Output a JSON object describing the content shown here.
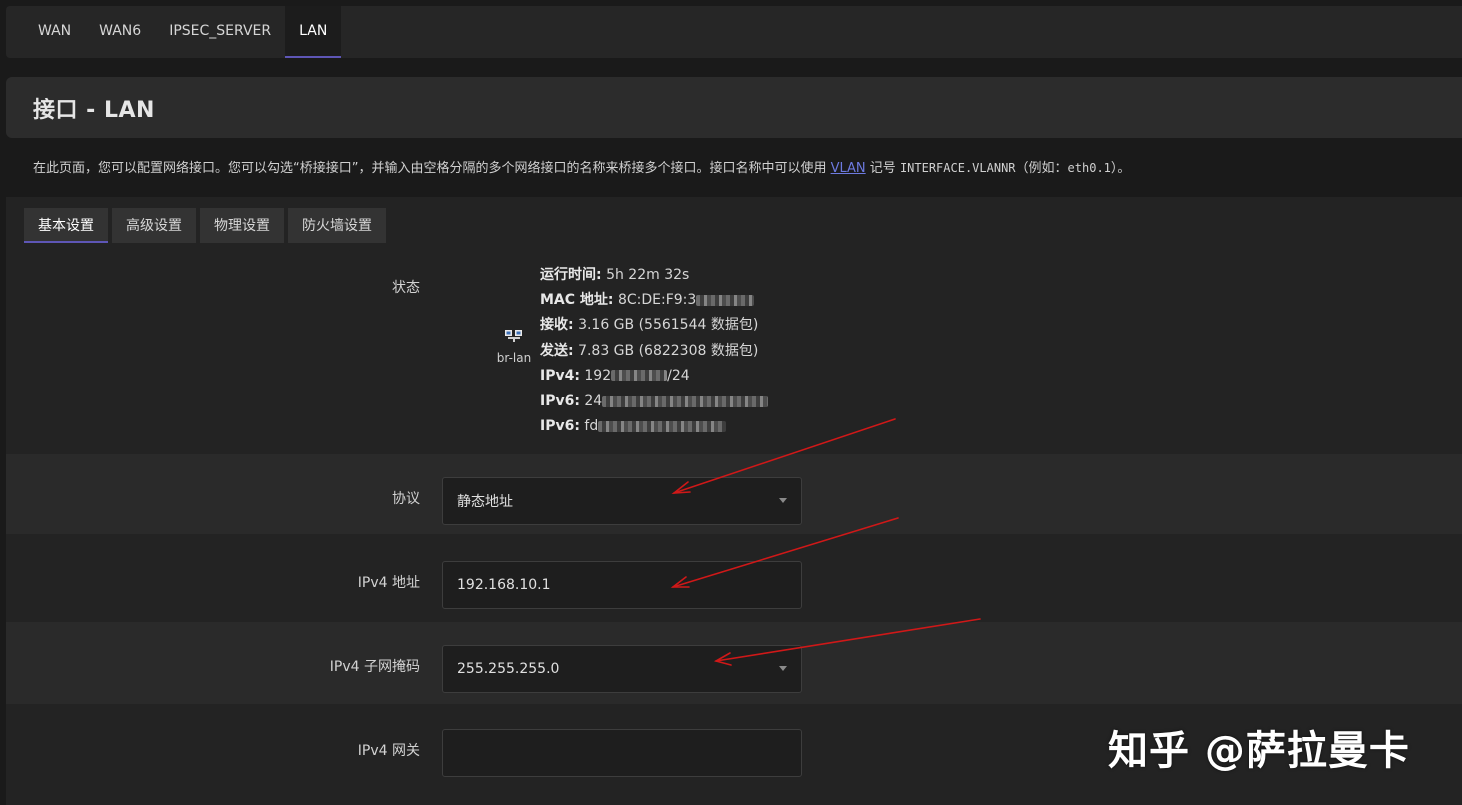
{
  "top_tabs": [
    {
      "label": "WAN",
      "active": false
    },
    {
      "label": "WAN6",
      "active": false
    },
    {
      "label": "IPSEC_SERVER",
      "active": false
    },
    {
      "label": "LAN",
      "active": true
    }
  ],
  "page_title": "接口 - LAN",
  "description": {
    "text_before": "在此页面，您可以配置网络接口。您可以勾选“桥接接口”，并输入由空格分隔的多个网络接口的名称来桥接多个接口。接口名称中可以使用 ",
    "link": "VLAN",
    "text_mid": " 记号 ",
    "code1": "INTERFACE.VLANNR",
    "text_mid2": "（例如：",
    "code2": "eth0.1",
    "text_after": "）。"
  },
  "sub_tabs": [
    {
      "label": "基本设置",
      "active": true
    },
    {
      "label": "高级设置",
      "active": false
    },
    {
      "label": "物理设置",
      "active": false
    },
    {
      "label": "防火墙设置",
      "active": false
    }
  ],
  "status": {
    "label": "状态",
    "iface": "br-lan",
    "icon": "network-bridge-icon",
    "uptime_label": "运行时间:",
    "uptime_value": "5h 22m 32s",
    "mac_label": "MAC 地址:",
    "mac_value": "8C:DE:F9:3",
    "rx_label": "接收:",
    "rx_value": "3.16 GB (5561544 数据包)",
    "tx_label": "发送:",
    "tx_value": "7.83 GB (6822308 数据包)",
    "ipv4_label": "IPv4:",
    "ipv4_value_a": "192",
    "ipv4_value_b": "/24",
    "ipv6_label": "IPv6:",
    "ipv6_value_a": "24",
    "ipv6b_label": "IPv6:",
    "ipv6b_value_a": "fd"
  },
  "protocol": {
    "label": "协议",
    "value": "静态地址"
  },
  "ipv4_addr": {
    "label": "IPv4 地址",
    "value": "192.168.10.1"
  },
  "ipv4_mask": {
    "label": "IPv4 子网掩码",
    "value": "255.255.255.0"
  },
  "ipv4_gw": {
    "label": "IPv4 网关",
    "value": ""
  },
  "watermark": "知乎 @萨拉曼卡",
  "colors": {
    "accent": "#5e56b6",
    "annotation_arrow": "#d01818"
  }
}
